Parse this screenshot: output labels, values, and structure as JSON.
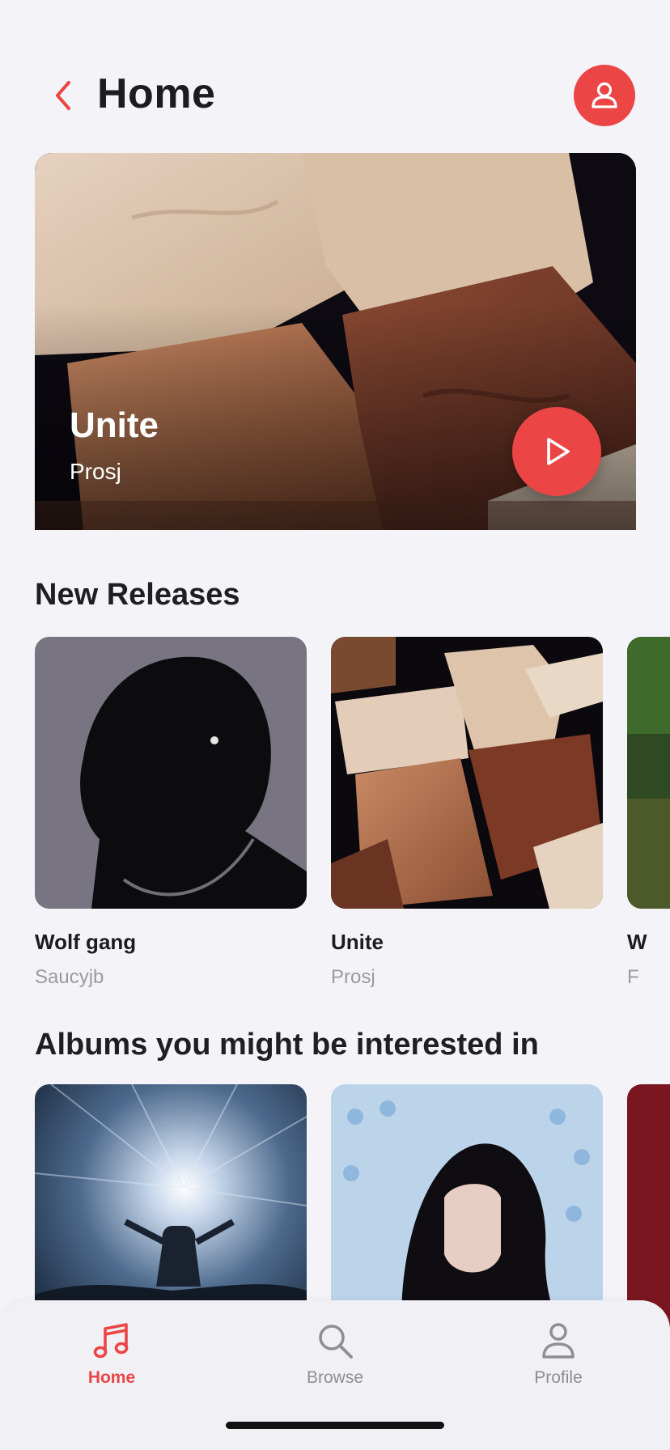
{
  "header": {
    "title": "Home"
  },
  "featured": {
    "title": "Unite",
    "artist": "Prosj"
  },
  "new_releases": {
    "heading": "New Releases",
    "items": [
      {
        "title": "Wolf gang",
        "artist": "Saucyjb"
      },
      {
        "title": "Unite",
        "artist": "Prosj"
      },
      {
        "title": "W",
        "artist": "F"
      }
    ]
  },
  "albums": {
    "heading": "Albums you might be interested in"
  },
  "tabs": [
    {
      "label": "Home",
      "active": true
    },
    {
      "label": "Browse",
      "active": false
    },
    {
      "label": "Profile",
      "active": false
    }
  ],
  "colors": {
    "accent": "#ec4546",
    "inactive": "#8e8e93",
    "background": "#f4f3f8"
  },
  "icons": {
    "back": "chevron-left-icon",
    "avatar": "person-icon",
    "play": "play-icon",
    "home": "music-note-icon",
    "browse": "search-icon",
    "profile": "person-icon"
  }
}
